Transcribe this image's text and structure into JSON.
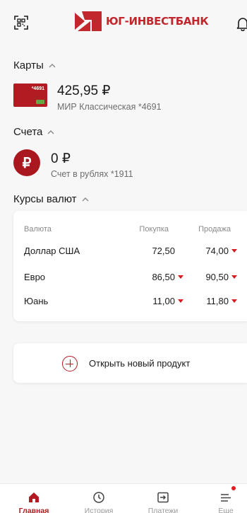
{
  "header": {
    "logo_text": "ЮГ-ИНВЕСТБАНК"
  },
  "cards_section": {
    "title": "Карты",
    "items": [
      {
        "thumb_number": "*4691",
        "amount": "425,95 ₽",
        "subtitle": "МИР Классическая *4691"
      }
    ]
  },
  "accounts_section": {
    "title": "Счета",
    "items": [
      {
        "currency_glyph": "₽",
        "amount": "0 ₽",
        "subtitle": "Счет в рублях *1911"
      }
    ]
  },
  "rates_section": {
    "title": "Курсы валют",
    "headers": {
      "currency": "Валюта",
      "buy": "Покупка",
      "sell": "Продажа"
    },
    "rows": [
      {
        "name": "Доллар США",
        "buy": "72,50",
        "buy_trend": "none",
        "sell": "74,00",
        "sell_trend": "down"
      },
      {
        "name": "Евро",
        "buy": "86,50",
        "buy_trend": "down",
        "sell": "90,50",
        "sell_trend": "down"
      },
      {
        "name": "Юань",
        "buy": "11,00",
        "buy_trend": "down",
        "sell": "11,80",
        "sell_trend": "down"
      }
    ]
  },
  "new_product": {
    "label": "Открыть новый продукт"
  },
  "tabbar": {
    "tabs": [
      {
        "label": "Главная",
        "icon": "home-icon",
        "active": true
      },
      {
        "label": "История",
        "icon": "clock-icon",
        "active": false
      },
      {
        "label": "Платежи",
        "icon": "transfer-icon",
        "active": false
      },
      {
        "label": "Еще",
        "icon": "menu-icon",
        "active": false,
        "badge": true
      }
    ]
  },
  "colors": {
    "brand": "#b31b22",
    "trend_down": "#d81c22",
    "background": "#f7f7f7"
  }
}
